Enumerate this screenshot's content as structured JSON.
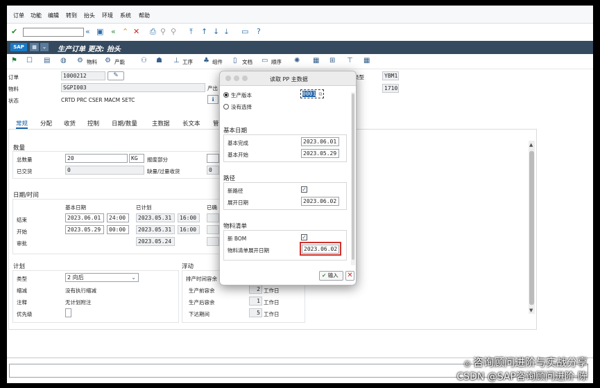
{
  "menu": [
    "订单",
    "功能",
    "编辑",
    "转到",
    "抬头",
    "环境",
    "系统",
    "帮助"
  ],
  "sap_logo": "SAP",
  "window_title": "生产订单 更改: 抬头",
  "app_toolbar": {
    "material": "物料",
    "capacity": "产能",
    "operation": "工序",
    "components": "组件",
    "documents": "文档",
    "sequence": "顺序"
  },
  "header": {
    "order_label": "订单",
    "order_value": "1000212",
    "material_label": "物料",
    "material_value": "SGPI003",
    "status_label": "状态",
    "status_value": "CRTD PRC  CSER MACM SETC",
    "output_label": "产出",
    "type_label": "类型",
    "type_value": "YBM1",
    "plant_value": "1710"
  },
  "tabs": [
    "常规",
    "分配",
    "收货",
    "控制",
    "日期/数量",
    "主数据",
    "长文本",
    "管"
  ],
  "quantity": {
    "title": "数量",
    "total_label": "总数量",
    "total_value": "20",
    "unit": "KG",
    "scrap_label": "报废部分",
    "delivered_label": "已交货",
    "delivered_value": "0",
    "shortage_label": "缺量/过量收货",
    "shortage_value": "0"
  },
  "dates": {
    "title": "日期/时间",
    "basic_label": "基本日期",
    "planned_label": "已计划",
    "confirmed_label": "已确",
    "end_label": "结束",
    "end_basic_date": "2023.06.01",
    "end_basic_time": "24:00",
    "end_planned_date": "2023.05.31",
    "end_planned_time": "16:00",
    "start_label": "开始",
    "start_basic_date": "2023.05.29",
    "start_basic_time": "00:00",
    "start_planned_date": "2023.05.31",
    "start_planned_time": "16:00",
    "release_label": "审批",
    "release_planned_date": "2023.05.24"
  },
  "planning": {
    "title": "计划",
    "type_label": "类型",
    "type_value": "2 向后",
    "reduction_label": "缩减",
    "reduction_value": "没有执行缩减",
    "note_label": "注释",
    "note_value": "无计划附注",
    "priority_label": "优先级"
  },
  "float": {
    "title": "浮动",
    "sched_margin_label": "排产时间容余",
    "before_label": "生产前容余",
    "before_value": "2",
    "after_label": "生产后容余",
    "after_value": "1",
    "release_label": "下达期间",
    "release_value": "5",
    "unit": "工作日"
  },
  "dialog": {
    "title": "读取 PP 主数据",
    "prod_version_label": "生产版本",
    "prod_version_value": "0001",
    "no_selection_label": "没有选择",
    "basic_dates_title": "基本日期",
    "basic_finish_label": "基本完成",
    "basic_finish_value": "2023.06.01",
    "basic_start_label": "基本开始",
    "basic_start_value": "2023.05.29",
    "routing_title": "路径",
    "new_routing_label": "新路径",
    "explode_date_label": "展开日期",
    "explode_date_value": "2023.06.02",
    "bom_title": "物料清单",
    "new_bom_label": "新 BOM",
    "bom_explode_label": "物料清单展开日期",
    "bom_explode_value": "2023.06.02",
    "ok_label": "输入"
  },
  "watermark": {
    "line1": "咨询顾问进阶与实战分享",
    "line2": "CSDN @SAP咨询顾问进阶-陈"
  },
  "colors": {
    "title_bar": "#354a5f",
    "highlight": "#d0302b",
    "accent": "#1b5fa8"
  }
}
